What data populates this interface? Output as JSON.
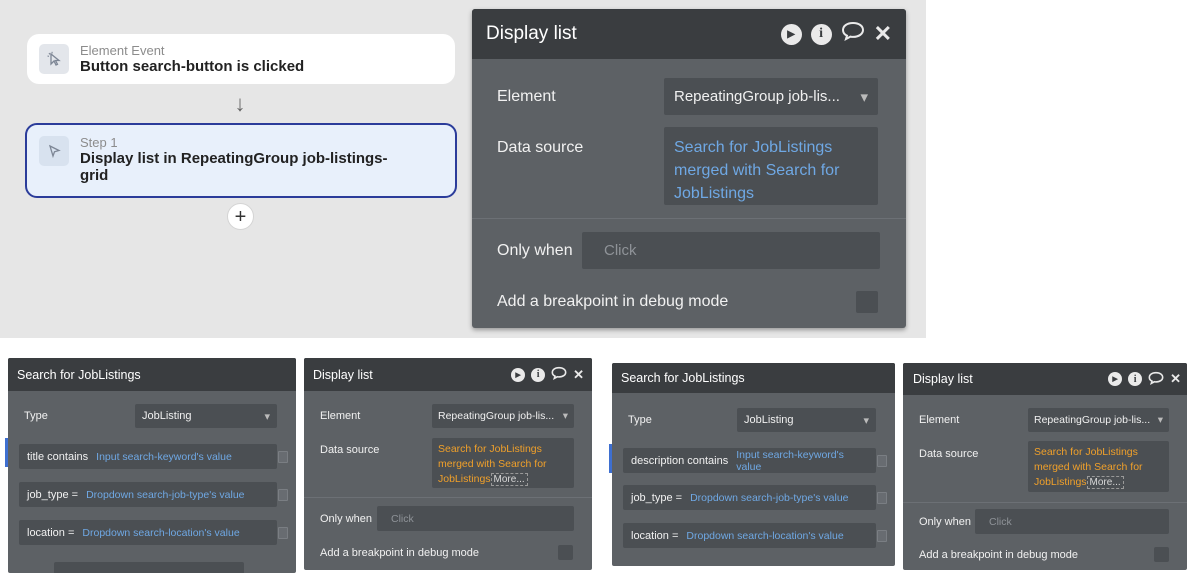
{
  "workflow": {
    "event_card": {
      "kind": "Element Event",
      "title": "Button search-button is clicked",
      "icon": "pointer-click-icon"
    },
    "step_card": {
      "kind": "Step 1",
      "title": "Display list in RepeatingGroup job-listings-grid",
      "icon": "cursor-arrow-icon"
    },
    "add_step_label": "+"
  },
  "big_display_panel": {
    "title": "Display list",
    "element_label": "Element",
    "element_value": "RepeatingGroup job-lis...",
    "data_source_label": "Data source",
    "data_source_value": "Search for JobListings merged with Search for JobListings",
    "only_when_label": "Only when",
    "only_when_placeholder": "Click",
    "breakpoint_label": "Add a breakpoint in debug mode"
  },
  "search_panel_left": {
    "title": "Search for JobListings",
    "type_label": "Type",
    "type_value": "JobListing",
    "constraints": [
      {
        "label": "title contains",
        "value": "Input search-keyword's value"
      },
      {
        "label": "job_type =",
        "value": "Dropdown search-job-type's value"
      },
      {
        "label": "location =",
        "value": "Dropdown search-location's value"
      }
    ]
  },
  "display_panel_small_1": {
    "title": "Display list",
    "element_label": "Element",
    "element_value": "RepeatingGroup job-lis...",
    "data_source_label": "Data source",
    "data_source_value": "Search for JobListings merged with Search for JobListings",
    "more_label": "More...",
    "only_when_label": "Only when",
    "only_when_placeholder": "Click",
    "breakpoint_label": "Add a breakpoint in debug mode"
  },
  "search_panel_right": {
    "title": "Search for JobListings",
    "type_label": "Type",
    "type_value": "JobListing",
    "constraints": [
      {
        "label": "description contains",
        "value": "Input search-keyword's value"
      },
      {
        "label": "job_type =",
        "value": "Dropdown search-job-type's value"
      },
      {
        "label": "location =",
        "value": "Dropdown search-location's value"
      }
    ]
  },
  "display_panel_small_2": {
    "title": "Display list",
    "element_label": "Element",
    "element_value": "RepeatingGroup job-lis...",
    "data_source_label": "Data source",
    "data_source_value": "Search for JobListings merged with Search for JobListings",
    "more_label": "More...",
    "only_when_label": "Only when",
    "only_when_placeholder": "Click",
    "breakpoint_label": "Add a breakpoint in debug mode"
  },
  "colors": {
    "panel_bg": "#5d6165",
    "header_bg": "#3a3d40",
    "field_bg": "#4b4f53",
    "link_blue": "#6fa8e4",
    "expression_orange": "#f0a02a",
    "step_border": "#2b3c9a"
  }
}
